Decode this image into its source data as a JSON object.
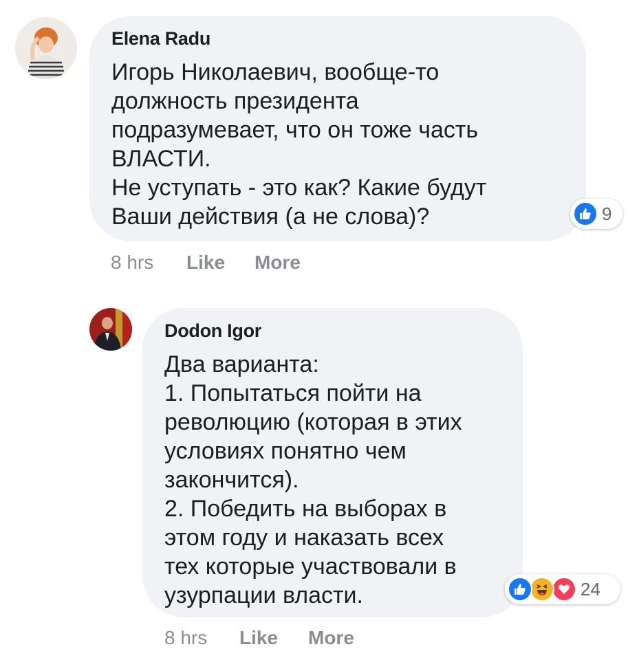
{
  "comments": [
    {
      "author": "Elena Radu",
      "lines": [
        "Игорь Николаевич, вообще-то",
        "должность президента",
        "подразумевает, что он тоже часть",
        "ВЛАСТИ.",
        "Не уступать - это как? Какие будут",
        "Ваши действия (а не слова)?"
      ],
      "time": "8 hrs",
      "like_label": "Like",
      "more_label": "More",
      "reactions": {
        "icons": [
          "like-icon"
        ],
        "count": "9"
      }
    },
    {
      "author": "Dodon Igor",
      "lines": [
        "Два варианта:",
        "1. Попытаться пойти на",
        "революцию (которая в этих",
        "условиях понятно чем",
        "закончится).",
        "2. Победить на выборах в",
        "этом году и наказать всех",
        "тех которые участвовали в",
        "узурпации власти."
      ],
      "time": "8 hrs",
      "like_label": "Like",
      "more_label": "More",
      "reactions": {
        "icons": [
          "like-icon",
          "haha-icon",
          "love-icon"
        ],
        "count": "24"
      }
    }
  ],
  "colors": {
    "bubble": "#f0f2f5",
    "like_blue": "#1877f2",
    "love_red": "#f33e58",
    "haha_yellow": "#f7b125",
    "meta_gray": "#8a8d91"
  }
}
